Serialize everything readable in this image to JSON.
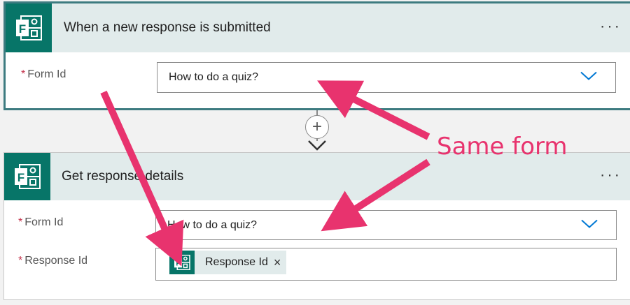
{
  "trigger": {
    "title": "When a new response is submitted",
    "more_label": "···",
    "icon": "forms-icon",
    "fields": [
      {
        "label": "Form Id",
        "required_mark": "*",
        "value": "How to do a quiz?"
      }
    ]
  },
  "connector": {
    "add_label": "+"
  },
  "action": {
    "title": "Get response details",
    "more_label": "···",
    "icon": "forms-icon",
    "fields": [
      {
        "label": "Form Id",
        "required_mark": "*",
        "value": "How to do a quiz?"
      },
      {
        "label": "Response Id",
        "required_mark": "*",
        "token_label": "Response Id",
        "token_remove": "×"
      }
    ]
  },
  "annotation": {
    "text": "Same form",
    "color": "#e8336e"
  },
  "colors": {
    "forms_teal": "#077568",
    "header_bg": "#e1ebeb",
    "selected_border": "#3d7b80",
    "required": "#c4314b",
    "chevron": "#0078d4"
  }
}
